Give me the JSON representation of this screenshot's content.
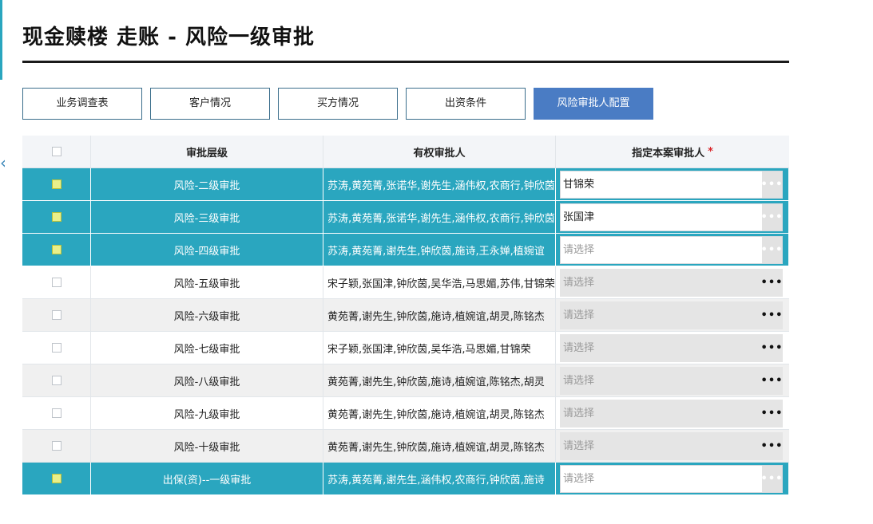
{
  "page": {
    "title": "现金赎楼 走账 - 风险一级审批"
  },
  "tabs": [
    {
      "label": "业务调查表",
      "active": false
    },
    {
      "label": "客户情况",
      "active": false
    },
    {
      "label": "买方情况",
      "active": false
    },
    {
      "label": "出资条件",
      "active": false
    },
    {
      "label": "风险审批人配置",
      "active": true
    }
  ],
  "table": {
    "headers": {
      "level": "审批层级",
      "approvers": "有权审批人",
      "assign": "指定本案审批人",
      "required_mark": "*"
    },
    "rows": [
      {
        "selected": true,
        "level": "风险-二级审批",
        "approvers": "苏涛,黄苑菁,张诺华,谢先生,涵伟权,农商行,钟欣茵",
        "assignee": "甘锦荣",
        "picker_state": "filled",
        "button": "•••"
      },
      {
        "selected": true,
        "level": "风险-三级审批",
        "approvers": "苏涛,黄苑菁,张诺华,谢先生,涵伟权,农商行,钟欣茵",
        "assignee": "张国津",
        "picker_state": "filled",
        "button": "•••"
      },
      {
        "selected": true,
        "level": "风险-四级审批",
        "approvers": "苏涛,黄苑菁,谢先生,钟欣茵,施诗,王永婵,植婉谊",
        "assignee": "请选择",
        "picker_state": "empty",
        "button": "•••"
      },
      {
        "selected": false,
        "level": "风险-五级审批",
        "approvers": "宋子颖,张国津,钟欣茵,吴华浩,马思媚,苏伟,甘锦荣",
        "assignee": "请选择",
        "picker_state": "disabled",
        "button": "•••"
      },
      {
        "selected": false,
        "level": "风险-六级审批",
        "approvers": "黄苑菁,谢先生,钟欣茵,施诗,植婉谊,胡灵,陈铭杰",
        "assignee": "请选择",
        "picker_state": "disabled",
        "button": "•••"
      },
      {
        "selected": false,
        "level": "风险-七级审批",
        "approvers": " 宋子颖,张国津,钟欣茵,吴华浩,马思媚,甘锦荣",
        "assignee": "请选择",
        "picker_state": "disabled",
        "button": "•••"
      },
      {
        "selected": false,
        "level": "风险-八级审批",
        "approvers": "黄苑菁,谢先生,钟欣茵,施诗,植婉谊,陈铭杰,胡灵",
        "assignee": "请选择",
        "picker_state": "disabled",
        "button": "•••"
      },
      {
        "selected": false,
        "level": "风险-九级审批",
        "approvers": "黄苑菁,谢先生,钟欣茵,施诗,植婉谊,胡灵,陈铭杰",
        "assignee": "请选择",
        "picker_state": "disabled",
        "button": "•••"
      },
      {
        "selected": false,
        "level": "风险-十级审批",
        "approvers": "黄苑菁,谢先生,钟欣茵,施诗,植婉谊,胡灵,陈铭杰",
        "assignee": "请选择",
        "picker_state": "disabled",
        "button": "•••"
      },
      {
        "selected": true,
        "level": "出保(资)--一级审批",
        "approvers": "苏涛,黄苑菁,谢先生,涵伟权,农商行,钟欣茵,施诗",
        "assignee": "请选择",
        "picker_state": "empty",
        "button": "•••"
      }
    ]
  },
  "colors": {
    "selected_row": "#2aa6bf",
    "active_tab": "#4a7cc4",
    "required": "#d9262b"
  }
}
